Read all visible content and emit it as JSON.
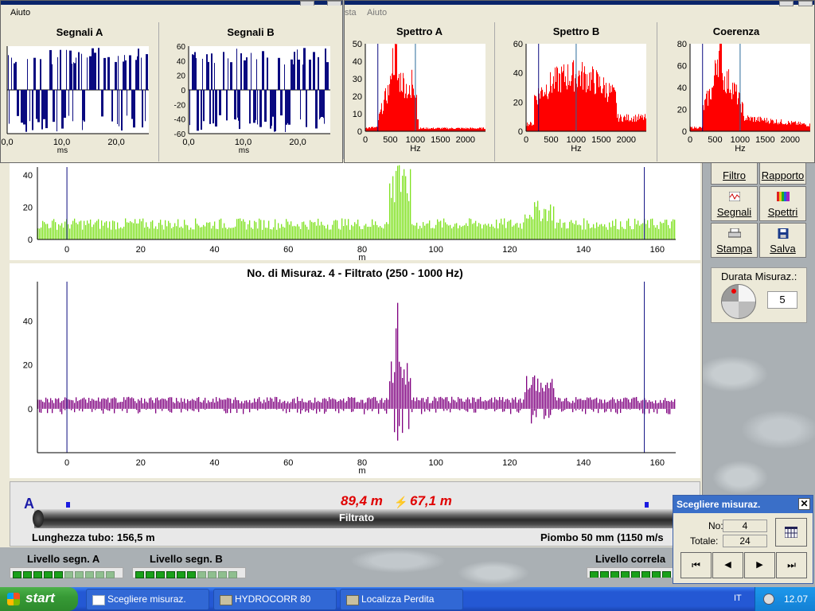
{
  "win_left": {
    "menu": "Aiuto",
    "charts": [
      {
        "title": "Segnali A",
        "xticks": [
          "0,0",
          "10,0",
          "20,0"
        ],
        "xlabel": "ms"
      },
      {
        "title": "Segnali B",
        "yticks": [
          "60",
          "40",
          "20",
          "0",
          "-20",
          "-40",
          "-60"
        ],
        "xticks": [
          "0,0",
          "10,0",
          "20,0"
        ],
        "xlabel": "ms"
      }
    ]
  },
  "win_right": {
    "menu_partial": "sta",
    "menu": "Aiuto",
    "charts": [
      {
        "title": "Spettro A",
        "yticks": [
          "50",
          "40",
          "30",
          "20",
          "10",
          "0"
        ],
        "xticks": [
          "0",
          "500",
          "1000",
          "1500",
          "2000"
        ],
        "xlabel": "Hz"
      },
      {
        "title": "Spettro B",
        "yticks": [
          "60",
          "40",
          "20",
          "0"
        ],
        "xticks": [
          "0",
          "500",
          "1000",
          "1500",
          "2000"
        ],
        "xlabel": "Hz"
      },
      {
        "title": "Coerenza",
        "yticks": [
          "80",
          "60",
          "40",
          "20",
          "0"
        ],
        "xticks": [
          "0",
          "500",
          "1000",
          "1500",
          "2000"
        ],
        "xlabel": "Hz"
      }
    ]
  },
  "corr_top": {
    "yticks": [
      "40",
      "20",
      "0"
    ],
    "xticks": [
      "0",
      "20",
      "40",
      "60",
      "80",
      "100",
      "120",
      "140",
      "160"
    ],
    "xlabel": "m"
  },
  "corr_filtered": {
    "title": "No. di Misuraz. 4 - Filtrato (250 - 1000 Hz)",
    "yticks": [
      "40",
      "20",
      "0"
    ],
    "xticks": [
      "0",
      "20",
      "40",
      "60",
      "80",
      "100",
      "120",
      "140",
      "160"
    ],
    "xlabel": "m"
  },
  "toolbar": {
    "filtro": "Filtro",
    "rapporto": "Rapporto",
    "segnali": "Segnali",
    "spettri": "Spettri",
    "stampa": "Stampa",
    "salva": "Salva",
    "durata_label": "Durata Misuraz.:",
    "durata_value": "5"
  },
  "pipe": {
    "label_a": "A",
    "dist_left": "89,4 m",
    "dist_right": "67,1 m",
    "mode": "Filtrato",
    "length": "Lunghezza tubo: 156,5 m",
    "material": "Piombo 50 mm (1150 m/s"
  },
  "levels": {
    "a": "Livello segn. A",
    "b": "Livello segn. B",
    "corr": "Livello correla"
  },
  "dialog": {
    "title": "Scegliere misuraz.",
    "no_label": "No:",
    "no_value": "4",
    "total_label": "Totale:",
    "total_value": "24"
  },
  "taskbar": {
    "start": "start",
    "items": [
      "Scegliere misuraz.",
      "HYDROCORR 80",
      "Localizza Perdita"
    ],
    "lang": "IT",
    "time": "12.07"
  },
  "colors": {
    "signal": "#0a0a80",
    "spectrum": "#ff0000",
    "corr_green": "#7fe11f",
    "corr_purple": "#800080",
    "marker": "#0a0a80"
  }
}
